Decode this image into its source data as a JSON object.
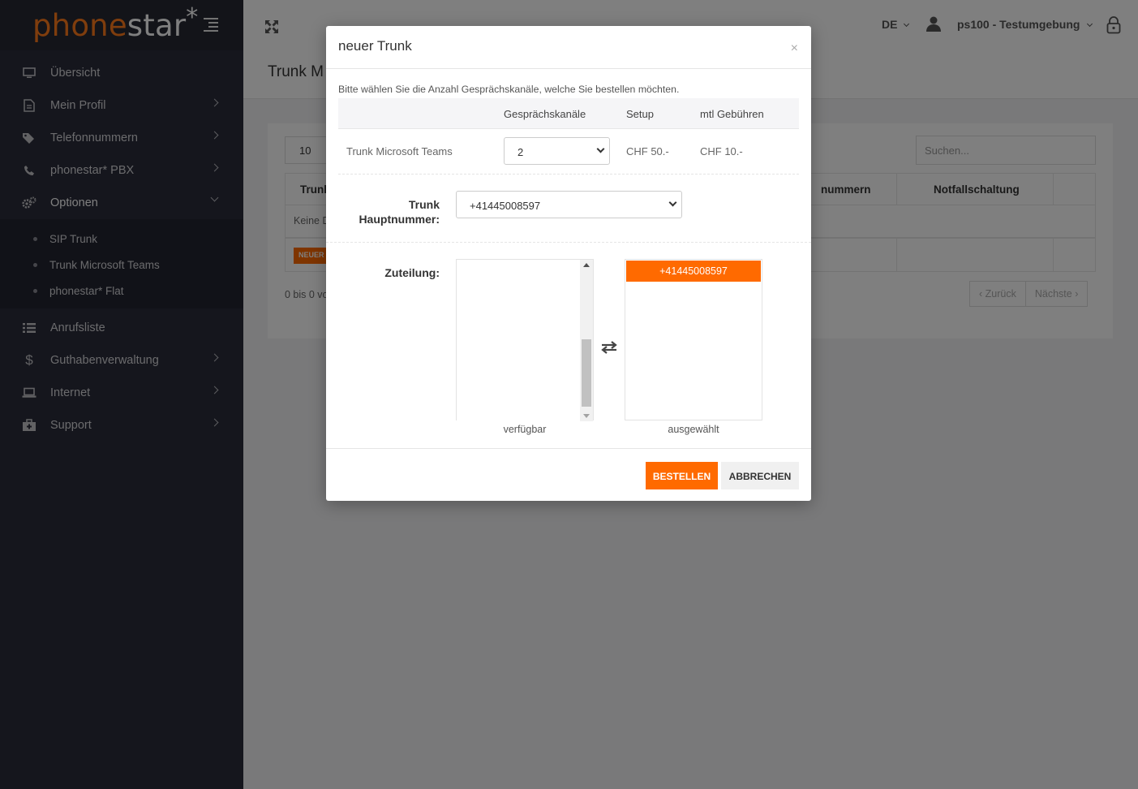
{
  "brand": {
    "part1": "phone",
    "part2": "star",
    "star": "*"
  },
  "sidebar": {
    "items": [
      {
        "label": "Übersicht",
        "icon": "monitor-icon"
      },
      {
        "label": "Mein Profil",
        "icon": "document-icon"
      },
      {
        "label": "Telefonnummern",
        "icon": "tags-icon"
      },
      {
        "label": "phonestar* PBX",
        "icon": "phone-icon"
      },
      {
        "label": "Optionen",
        "icon": "gears-icon"
      },
      {
        "label": "Anrufsliste",
        "icon": "list-icon"
      },
      {
        "label": "Guthabenverwaltung",
        "icon": "dollar-icon"
      },
      {
        "label": "Internet",
        "icon": "laptop-icon"
      },
      {
        "label": "Support",
        "icon": "medkit-icon"
      }
    ],
    "sub_items": [
      {
        "label": "SIP Trunk"
      },
      {
        "label": "Trunk Microsoft Teams"
      },
      {
        "label": "phonestar* Flat"
      }
    ]
  },
  "topbar": {
    "lang": "DE",
    "user": "ps100 - Testumgebung"
  },
  "page": {
    "title": "Trunk M",
    "page_length": "10",
    "search_placeholder": "Suchen...",
    "table": {
      "col_first": "Trunk",
      "col_numbers": "nummern",
      "col_emergency": "Notfallschaltung",
      "empty_text": "Keine D",
      "new_button": "NEUER"
    },
    "info": "0 bis 0 vo",
    "pager_prev": "Zurück",
    "pager_next": "Nächste"
  },
  "modal": {
    "title": "neuer Trunk",
    "close": "×",
    "intro": "Bitte wählen Sie die Anzahl Gesprächskanäle, welche Sie bestellen möchten.",
    "table": {
      "head_channels": "Gesprächskanäle",
      "head_setup": "Setup",
      "head_fee": "mtl Gebühren",
      "row_label": "Trunk Microsoft Teams",
      "row_channels": "2",
      "row_setup": "CHF 50.-",
      "row_fee": "CHF 10.-"
    },
    "main_number_label_1": "Trunk",
    "main_number_label_2": "Hauptnummer:",
    "main_number_value": "+41445008597",
    "allocation_label": "Zuteilung:",
    "available_caption": "verfügbar",
    "selected_caption": "ausgewählt",
    "selected_items": [
      "+41445008597"
    ],
    "btn_order": "BESTELLEN",
    "btn_cancel": "ABBRECHEN"
  },
  "colors": {
    "accent": "#ff6a00",
    "sidebar": "#2b2d3a"
  }
}
